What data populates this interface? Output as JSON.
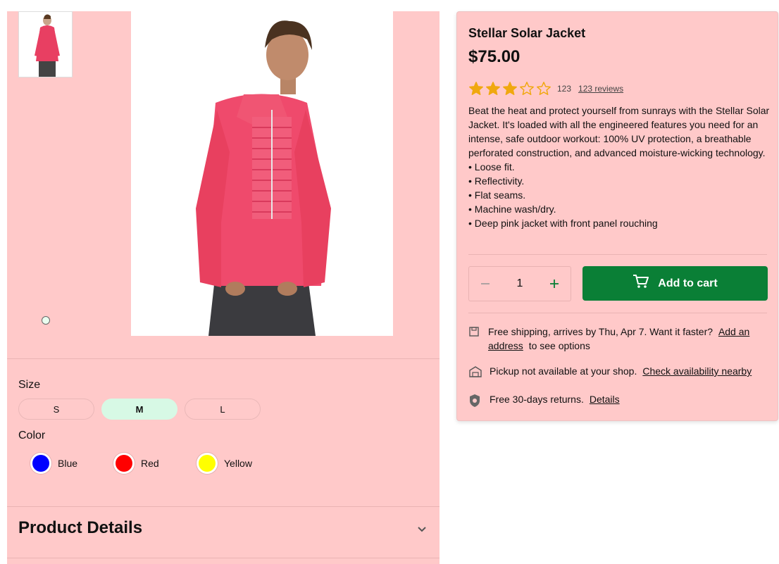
{
  "gallery": {
    "thumbnail_alt": "Stellar Solar Jacket thumbnail",
    "main_alt": "Stellar Solar Jacket"
  },
  "options": {
    "size_label": "Size",
    "sizes": [
      "S",
      "M",
      "L"
    ],
    "selected_size": "M",
    "color_label": "Color",
    "colors": [
      {
        "name": "Blue",
        "hex": "#0000ff"
      },
      {
        "name": "Red",
        "hex": "#ff0000"
      },
      {
        "name": "Yellow",
        "hex": "#ffff00"
      }
    ]
  },
  "details": {
    "title": "Product Details"
  },
  "product": {
    "title": "Stellar Solar Jacket",
    "price": "$75.00",
    "rating": 3,
    "rating_max": 5,
    "rating_count": "123",
    "reviews_link": "123 reviews",
    "description": "Beat the heat and protect yourself from sunrays with the Stellar Solar Jacket. It's loaded with all the engineered features you need for an intense, safe outdoor workout: 100% UV protection, a breathable perforated construction, and advanced moisture-wicking technology.",
    "bullets": [
      "• Loose fit.",
      "• Reflectivity.",
      "• Flat seams.",
      "• Machine wash/dry.",
      "• Deep pink jacket with front panel rouching"
    ]
  },
  "cart": {
    "quantity": "1",
    "add_label": "Add to cart",
    "accent": "#0a7f36"
  },
  "fulfillment": {
    "shipping_text": "Free shipping, arrives by Thu, Apr 7. Want it faster?",
    "shipping_link_1": "Add an",
    "shipping_link_2": "address",
    "shipping_suffix": "to see options",
    "pickup_text": "Pickup not available at your shop.",
    "pickup_link": "Check availability nearby",
    "returns_text": "Free 30-days returns.",
    "returns_link": "Details"
  },
  "theme": {
    "panel_bg": "#ffc9c9",
    "star_color": "#f0a80f"
  }
}
